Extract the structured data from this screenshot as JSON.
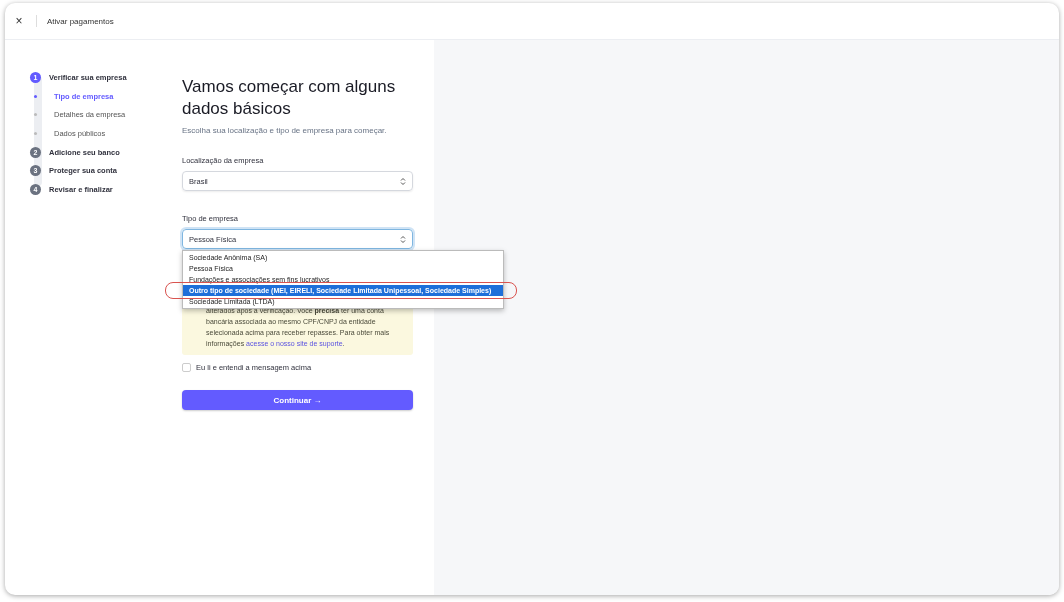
{
  "header": {
    "close": "×",
    "title": "Ativar pagamentos"
  },
  "steps": [
    {
      "number": "1",
      "label": "Verificar sua empresa",
      "selected": true,
      "children": [
        {
          "label": "Tipo de empresa",
          "selected": true
        },
        {
          "label": "Detalhes da empresa",
          "selected": false
        },
        {
          "label": "Dados públicos",
          "selected": false
        }
      ]
    },
    {
      "number": "2",
      "label": "Adicione seu banco",
      "selected": false
    },
    {
      "number": "3",
      "label": "Proteger sua conta",
      "selected": false
    },
    {
      "number": "4",
      "label": "Revisar e finalizar",
      "selected": false
    }
  ],
  "heading": "Vamos começar com alguns dados básicos",
  "subheading": "Escolha sua localização e tipo de empresa para começar.",
  "location": {
    "label": "Localização da empresa",
    "value": "Brasil"
  },
  "business_type": {
    "label": "Tipo de empresa",
    "value": "Pessoa Física",
    "expanded": true,
    "options": [
      {
        "label": "Sociedade Anônima (SA)",
        "highlighted": false,
        "circled": false
      },
      {
        "label": "Pessoa Física",
        "highlighted": false,
        "circled": false
      },
      {
        "label": "Fundações e associações sem fins lucrativos",
        "highlighted": false,
        "circled": false
      },
      {
        "label": "Outro tipo de sociedade (MEI, EIRELI, Sociedade Limitada Unipessoal, Sociedade Simples)",
        "highlighted": true,
        "circled": true
      },
      {
        "label": "Sociedade Limitada (LTDA)",
        "highlighted": false,
        "circled": false
      }
    ]
  },
  "notice": {
    "text": "alterados após a verificação. Você **precisa** ter uma conta bancária associada ao mesmo CPF/CNPJ da entidade selecionada acima para receber repasses. Para obter mais informações",
    "link": "acesse o nosso site de suporte",
    "end": "."
  },
  "acknowledge": {
    "label": "Eu li e entendi a mensagem acima",
    "checked": false
  },
  "continue_button": {
    "label": "Continuar",
    "arrow": "→"
  }
}
